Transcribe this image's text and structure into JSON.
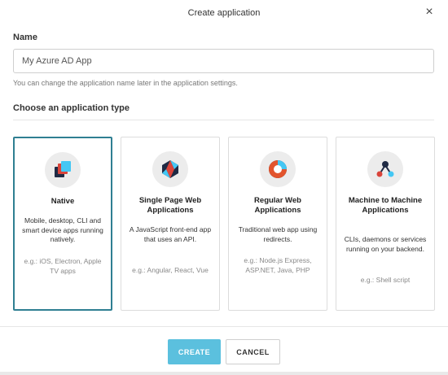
{
  "dialog": {
    "title": "Create application",
    "close_icon": "close-icon",
    "close_glyph": "×"
  },
  "name_field": {
    "label": "Name",
    "value": "My Azure AD App",
    "help": "You can change the application name later in the application settings."
  },
  "app_type": {
    "label": "Choose an application type",
    "selected": "native",
    "selected_border_color": "#2f7f92",
    "cards": [
      {
        "id": "native",
        "icon": "native-app-icon",
        "title": "Native",
        "description": "Mobile, desktop, CLI and smart device apps running natively.",
        "examples": "e.g.: iOS, Electron, Apple TV apps"
      },
      {
        "id": "spa",
        "icon": "single-page-app-icon",
        "title": "Single Page Web Applications",
        "description": "A JavaScript front-end app that uses an API.",
        "examples": "e.g.: Angular, React, Vue"
      },
      {
        "id": "rwa",
        "icon": "regular-web-app-icon",
        "title": "Regular Web Applications",
        "description": "Traditional web app using redirects.",
        "examples": "e.g.: Node.js Express, ASP.NET, Java, PHP"
      },
      {
        "id": "m2m",
        "icon": "machine-to-machine-icon",
        "title": "Machine to Machine Applications",
        "description": "CLIs, daemons or services running on your backend.",
        "examples": "e.g.: Shell script"
      }
    ]
  },
  "footer": {
    "create_label": "CREATE",
    "cancel_label": "CANCEL",
    "create_color": "#5bc0de"
  }
}
